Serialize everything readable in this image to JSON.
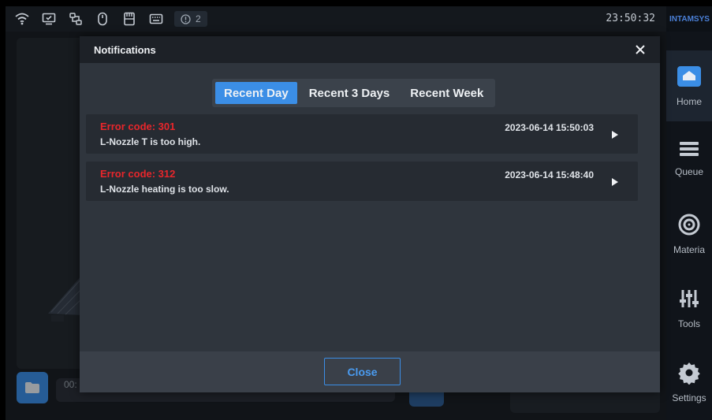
{
  "status_bar": {
    "icons": [
      "wifi-icon",
      "monitor-icon",
      "network-icon",
      "mouse-icon",
      "sd-card-icon",
      "keyboard-icon"
    ],
    "alert_count": "2",
    "time": "23:50:32"
  },
  "sidebar": {
    "brand": "INTAMSYS",
    "items": [
      {
        "label": "Home",
        "icon": "home-icon",
        "active": true
      },
      {
        "label": "Queue",
        "icon": "queue-icon"
      },
      {
        "label": "Materia",
        "icon": "material-spool-icon"
      },
      {
        "label": "Tools",
        "icon": "sliders-icon"
      },
      {
        "label": "Settings",
        "icon": "gear-icon"
      }
    ]
  },
  "background": {
    "partial_text": "00:"
  },
  "modal": {
    "title": "Notifications",
    "tabs": [
      "Recent Day",
      "Recent 3 Days",
      "Recent Week"
    ],
    "active_tab": "Recent Day",
    "notifications": [
      {
        "code": "Error code: 301",
        "message": "L-Nozzle T is too high.",
        "timestamp": "2023-06-14 15:50:03"
      },
      {
        "code": "Error code: 312",
        "message": "L-Nozzle heating is too slow.",
        "timestamp": "2023-06-14 15:48:40"
      }
    ],
    "close_label": "Close"
  },
  "colors": {
    "accent": "#3b8ee6",
    "error": "#e8262b",
    "modal_bg": "#2f353d"
  }
}
